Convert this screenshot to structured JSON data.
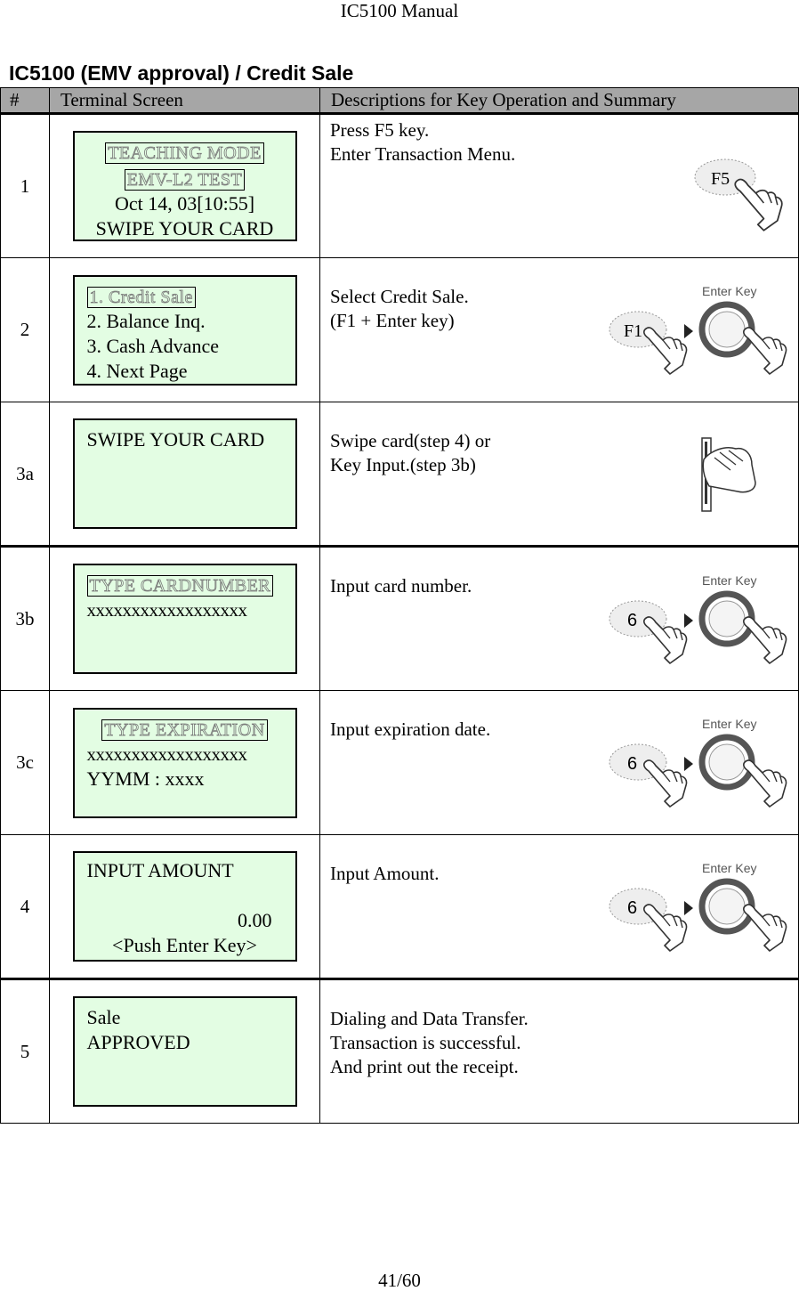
{
  "header": {
    "running_title": "IC5100 Manual"
  },
  "section": {
    "title": "IC5100 (EMV approval) / Credit Sale"
  },
  "table": {
    "columns": [
      "#",
      "Terminal Screen",
      "Descriptions for Key Operation and Summary"
    ],
    "rows": [
      {
        "num": "1",
        "screen": {
          "highlight": [
            "TEACHING MODE",
            "EMV-L2 TEST"
          ],
          "lines": [
            "Oct 14, 03[10:55]",
            "SWIPE YOUR CARD"
          ]
        },
        "desc": [
          "Press F5 key.",
          "Enter Transaction Menu."
        ],
        "illustration": {
          "type": "single-key-press",
          "key_label": "F5"
        }
      },
      {
        "num": "2",
        "screen": {
          "highlight": [
            "1. Credit Sale"
          ],
          "lines": [
            "2. Balance Inq.",
            "3. Cash Advance",
            "4. Next Page"
          ]
        },
        "desc": [
          "Select Credit Sale.",
          "(F1 + Enter key)"
        ],
        "illustration": {
          "type": "key-then-enter",
          "key_label": "F1",
          "enter_label": "Enter Key"
        }
      },
      {
        "num": "3a",
        "screen": {
          "lines": [
            "SWIPE YOUR CARD"
          ]
        },
        "desc": [
          "Swipe card(step 4) or",
          "Key Input.(step 3b)"
        ],
        "illustration": {
          "type": "card-swipe"
        }
      },
      {
        "num": "3b",
        "screen": {
          "highlight": [
            "TYPE CARDNUMBER"
          ],
          "lines": [
            "xxxxxxxxxxxxxxxxxx"
          ]
        },
        "desc": [
          "Input card number."
        ],
        "illustration": {
          "type": "key-then-enter",
          "key_label": "6",
          "enter_label": "Enter Key"
        }
      },
      {
        "num": "3c",
        "screen": {
          "highlight": [
            "TYPE EXPIRATION"
          ],
          "lines": [
            "xxxxxxxxxxxxxxxxxx",
            "YYMM : xxxx"
          ]
        },
        "desc": [
          "Input expiration date."
        ],
        "illustration": {
          "type": "key-then-enter",
          "key_label": "6",
          "enter_label": "Enter Key"
        }
      },
      {
        "num": "4",
        "screen": {
          "lines": [
            "INPUT AMOUNT",
            "0.00",
            "<Push Enter Key>"
          ]
        },
        "desc": [
          "Input Amount."
        ],
        "illustration": {
          "type": "key-then-enter",
          "key_label": "6",
          "enter_label": "Enter Key"
        }
      },
      {
        "num": "5",
        "screen": {
          "lines": [
            "Sale",
            "APPROVED"
          ]
        },
        "desc": [
          "Dialing and Data Transfer.",
          "Transaction is successful.",
          "And print out the receipt."
        ]
      }
    ]
  },
  "colors": {
    "screen_bg": "#e3fde3",
    "header_bg": "#a6a6a6"
  },
  "footer": {
    "page": "41/60"
  }
}
